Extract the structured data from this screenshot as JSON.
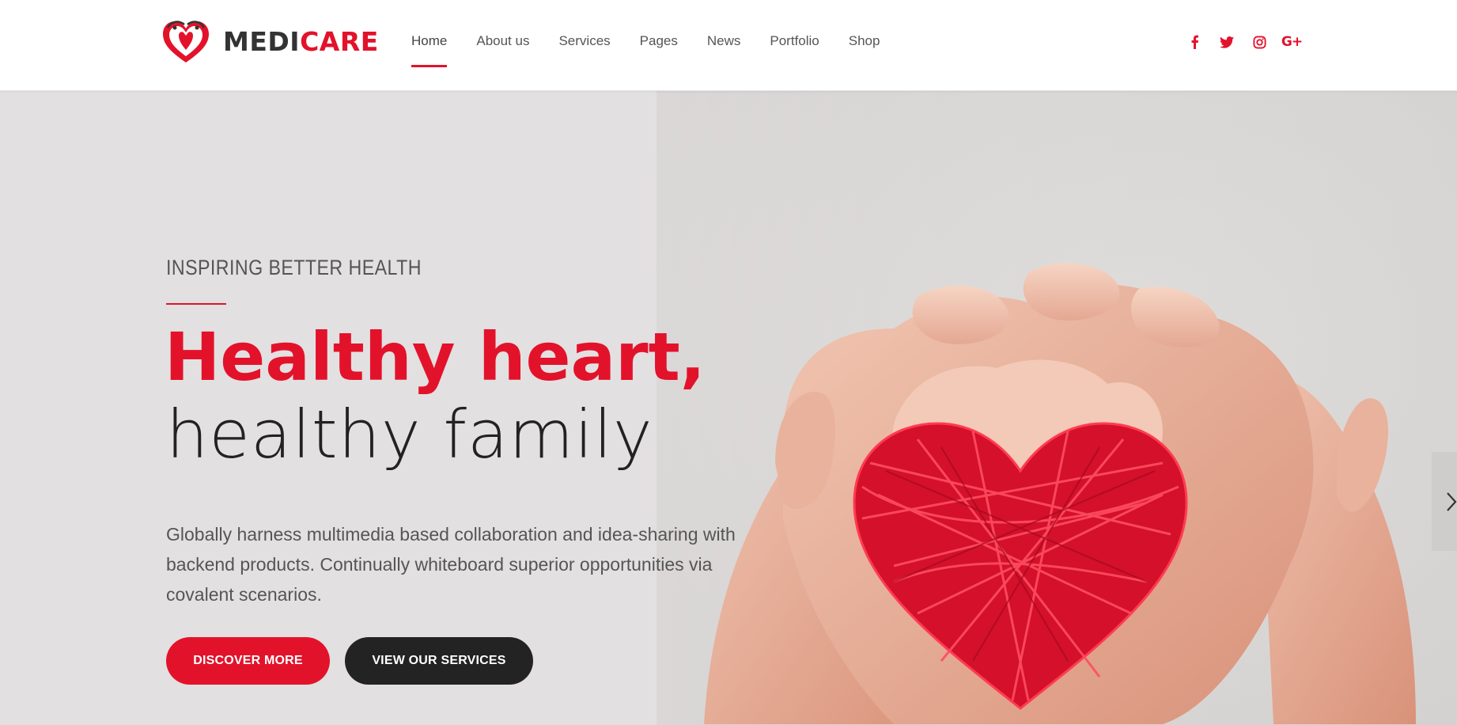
{
  "brand": {
    "name_part1": "MEDI",
    "name_part2": "CARE",
    "accent_color": "#e3122b",
    "dark_color": "#232323"
  },
  "nav": {
    "items": [
      {
        "label": "Home",
        "active": true
      },
      {
        "label": "About us"
      },
      {
        "label": "Services"
      },
      {
        "label": "Pages"
      },
      {
        "label": "News"
      },
      {
        "label": "Portfolio"
      },
      {
        "label": "Shop"
      }
    ]
  },
  "social": [
    "facebook-icon",
    "twitter-icon",
    "instagram-icon",
    "google-plus-icon"
  ],
  "hero": {
    "eyebrow": "INSPIRING BETTER HEALTH",
    "headline_line1": "Healthy heart,",
    "headline_line2": "healthy family",
    "description": "Globally harness multimedia based collaboration and idea-sharing with backend products. Continually whiteboard superior opportunities via covalent scenarios.",
    "primary_button": "DISCOVER MORE",
    "secondary_button": "VIEW OUR SERVICES"
  }
}
